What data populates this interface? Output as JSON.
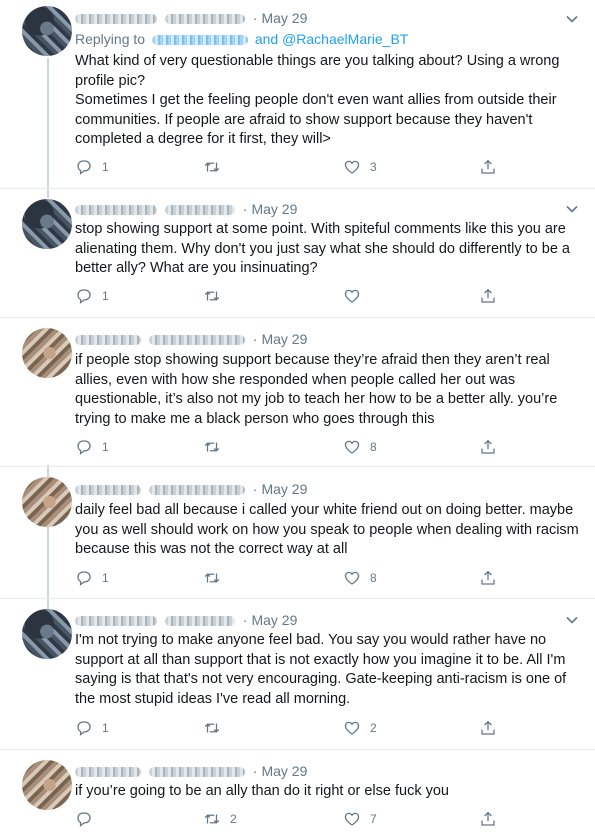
{
  "date": "May 29",
  "tweets": [
    {
      "id": 1,
      "date": "May 29",
      "reply_prefix": "Replying to",
      "reply_and": "and @RachaelMarie_BT",
      "text": "What kind of very questionable things are you talking about? Using a wrong profile pic?\nSometimes I get the feeling people don't even want allies from outside their communities. If people are afraid to show support because they haven't completed a degree for it first, they will>",
      "replies": "1",
      "retweets": "",
      "likes": "3"
    },
    {
      "id": 2,
      "date": "May 29",
      "text": "stop showing support at some point. With spiteful comments like this you are alienating them. Why don't you just say what she should do differently to be a better ally? What are you insinuating?",
      "replies": "1",
      "retweets": "",
      "likes": ""
    },
    {
      "id": 3,
      "date": "May 29",
      "text": "if people stop showing support because they’re afraid then they aren’t real allies, even with how she responded when people called her out was questionable, it’s also not my job to teach her how to be a better ally. you’re trying to make me a black person who goes through this",
      "replies": "1",
      "retweets": "",
      "likes": "8"
    },
    {
      "id": 4,
      "date": "May 29",
      "text": "daily feel bad all because i called your white friend out on doing better. maybe you as well should work on how you speak to people when dealing with racism because this was not the correct way at all",
      "replies": "1",
      "retweets": "",
      "likes": "8"
    },
    {
      "id": 5,
      "date": "May 29",
      "text": "I'm not trying to make anyone feel bad. You say you would rather have no support at all than support that is not exactly how you imagine it to be. All I'm saying is that that's not very encouraging. Gate-keeping anti-racism is one of the most stupid ideas I've read all morning.",
      "replies": "1",
      "retweets": "",
      "likes": "2"
    },
    {
      "id": 6,
      "date": "May 29",
      "text": "if you’re going to be an ally than do it right or else fuck you",
      "replies": "",
      "retweets": "2",
      "likes": "7"
    }
  ],
  "icons": {
    "reply": "reply-icon",
    "retweet": "retweet-icon",
    "like": "heart-icon",
    "share": "share-icon",
    "menu": "chevron-down-icon"
  },
  "colors": {
    "text": "#14171a",
    "muted": "#657786",
    "link": "#1da1f2",
    "thread": "#ccd6dd"
  }
}
